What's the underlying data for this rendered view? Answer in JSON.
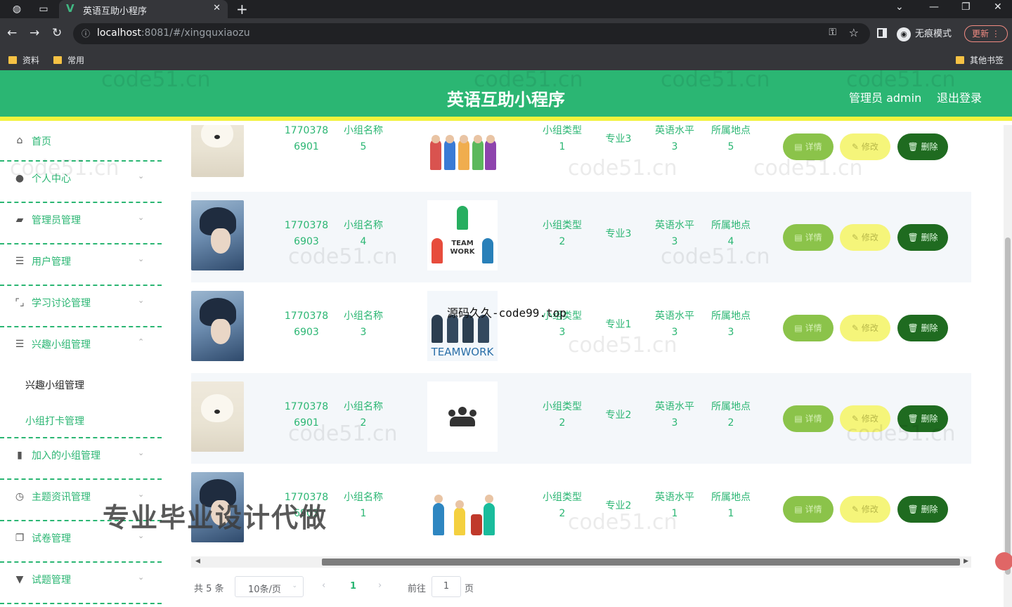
{
  "browser": {
    "tab_title": "英语互助小程序",
    "url_host": "localhost",
    "url_rest": ":8081/#/xingquxiaozu",
    "incognito_label": "无痕模式",
    "update_label": "更新",
    "bookmarks": [
      "资料",
      "常用"
    ],
    "other_bookmarks": "其他书签"
  },
  "header": {
    "title": "英语互助小程序",
    "admin_label": "管理员 admin",
    "logout_label": "退出登录"
  },
  "sidebar": {
    "items": [
      {
        "label": "首页",
        "icon": "home-icon"
      },
      {
        "label": "个人中心",
        "icon": "user-icon"
      },
      {
        "label": "管理员管理",
        "icon": "admin-icon"
      },
      {
        "label": "用户管理",
        "icon": "list-icon"
      },
      {
        "label": "学习讨论管理",
        "icon": "discussion-icon"
      },
      {
        "label": "兴趣小组管理",
        "icon": "list-icon"
      },
      {
        "label": "加入的小组管理",
        "icon": "chart-icon"
      },
      {
        "label": "主题资讯管理",
        "icon": "clock-icon"
      },
      {
        "label": "试卷管理",
        "icon": "copy-icon"
      },
      {
        "label": "试题管理",
        "icon": "pin-icon"
      }
    ],
    "submenu": [
      {
        "label": "兴趣小组管理"
      },
      {
        "label": "小组打卡管理"
      }
    ]
  },
  "table": {
    "rows": [
      {
        "avatar": "bear",
        "account": "1770378\n6901",
        "group_name": "小组名称\n5",
        "group_type": "小组类型\n1",
        "major": "专业3",
        "level": "英语水平\n3",
        "location": "所属地点\n5"
      },
      {
        "avatar": "boy",
        "account": "1770378\n6903",
        "group_name": "小组名称\n4",
        "group_type": "小组类型\n2",
        "major": "专业3",
        "level": "英语水平\n3",
        "location": "所属地点\n4"
      },
      {
        "avatar": "boy",
        "account": "1770378\n6903",
        "group_name": "小组名称\n3",
        "group_type": "小组类型\n3",
        "major": "专业1",
        "level": "英语水平\n3",
        "location": "所属地点\n3"
      },
      {
        "avatar": "bear",
        "account": "1770378\n6901",
        "group_name": "小组名称\n2",
        "group_type": "小组类型\n2",
        "major": "专业2",
        "level": "英语水平\n3",
        "location": "所属地点\n2"
      },
      {
        "avatar": "boy",
        "account": "1770378\n6903",
        "group_name": "小组名称\n1",
        "group_type": "小组类型\n2",
        "major": "专业2",
        "level": "英语水平\n1",
        "location": "所属地点\n1"
      }
    ],
    "buttons": {
      "detail": "详情",
      "edit": "修改",
      "delete": "删除"
    },
    "image_text": {
      "team_work": "TEAM\nWORK",
      "teamwork": "TEAMWORK"
    }
  },
  "pagination": {
    "total": "共 5 条",
    "page_size": "10条/页",
    "current_page": "1",
    "goto_label": "前往",
    "goto_value": "1",
    "page_suffix": "页"
  },
  "overlays": {
    "watermark_top": "源码久久-code99.top",
    "watermark_big": "专业毕业设计代做",
    "watermark_faint": "code51.cn"
  },
  "colors": {
    "primary": "#2bb673",
    "accent_bar": "#f2f23c",
    "detail": "#8bc34a",
    "edit": "#f5f57a",
    "delete": "#1f6b20"
  }
}
